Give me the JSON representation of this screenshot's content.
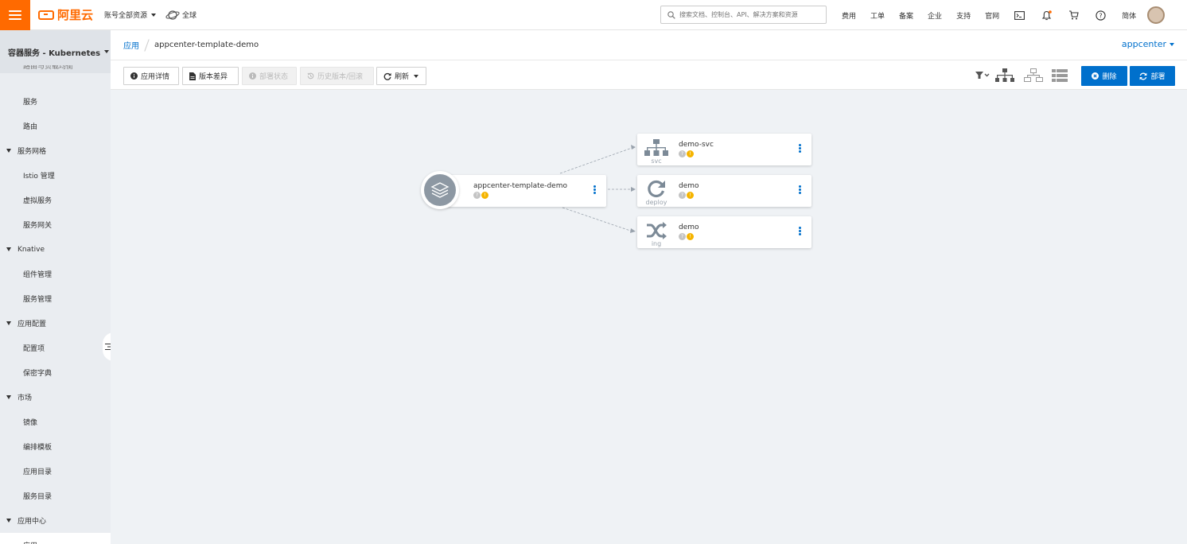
{
  "brand": {
    "name": "阿里云",
    "color": "#ff6a00"
  },
  "topbar": {
    "account_scope": "账号全部资源",
    "region": "全球",
    "search_placeholder": "搜索文档、控制台、API、解决方案和资源",
    "nav": [
      "费用",
      "工单",
      "备案",
      "企业",
      "支持",
      "官网"
    ],
    "language": "简体"
  },
  "sidebar": {
    "product": "容器服务 - Kubernetes",
    "cut_item": "路由与负载均衡",
    "items": [
      {
        "type": "item",
        "label": "服务"
      },
      {
        "type": "item",
        "label": "路由"
      },
      {
        "type": "group",
        "label": "服务网格"
      },
      {
        "type": "item",
        "label": "Istio 管理"
      },
      {
        "type": "item",
        "label": "虚拟服务"
      },
      {
        "type": "item",
        "label": "服务网关"
      },
      {
        "type": "group",
        "label": "Knative"
      },
      {
        "type": "item",
        "label": "组件管理"
      },
      {
        "type": "item",
        "label": "服务管理"
      },
      {
        "type": "group",
        "label": "应用配置"
      },
      {
        "type": "item",
        "label": "配置项"
      },
      {
        "type": "item",
        "label": "保密字典"
      },
      {
        "type": "group",
        "label": "市场"
      },
      {
        "type": "item",
        "label": "镜像"
      },
      {
        "type": "item",
        "label": "编排模板"
      },
      {
        "type": "item",
        "label": "应用目录"
      },
      {
        "type": "item",
        "label": "服务目录"
      },
      {
        "type": "group",
        "label": "应用中心"
      },
      {
        "type": "item",
        "label": "应用",
        "active": true
      }
    ]
  },
  "breadcrumb": {
    "parent": "应用",
    "current": "appcenter-template-demo"
  },
  "namespace": "appcenter",
  "toolbar": {
    "details": "应用详情",
    "diff": "版本差异",
    "deploy_status": "部署状态",
    "history": "历史版本/回滚",
    "refresh": "刷新",
    "delete": "删除",
    "deploy": "部署"
  },
  "topology": {
    "app": {
      "name": "appcenter-template-demo"
    },
    "resources": [
      {
        "name": "demo-svc",
        "kind": "svc",
        "icon": "service-tree-icon"
      },
      {
        "name": "demo",
        "kind": "deploy",
        "icon": "refresh-cycle-icon"
      },
      {
        "name": "demo",
        "kind": "ing",
        "icon": "shuffle-icon"
      }
    ]
  },
  "colors": {
    "primary": "#0070cc",
    "warning": "#f5b400",
    "unknown": "#c4c4c4"
  }
}
